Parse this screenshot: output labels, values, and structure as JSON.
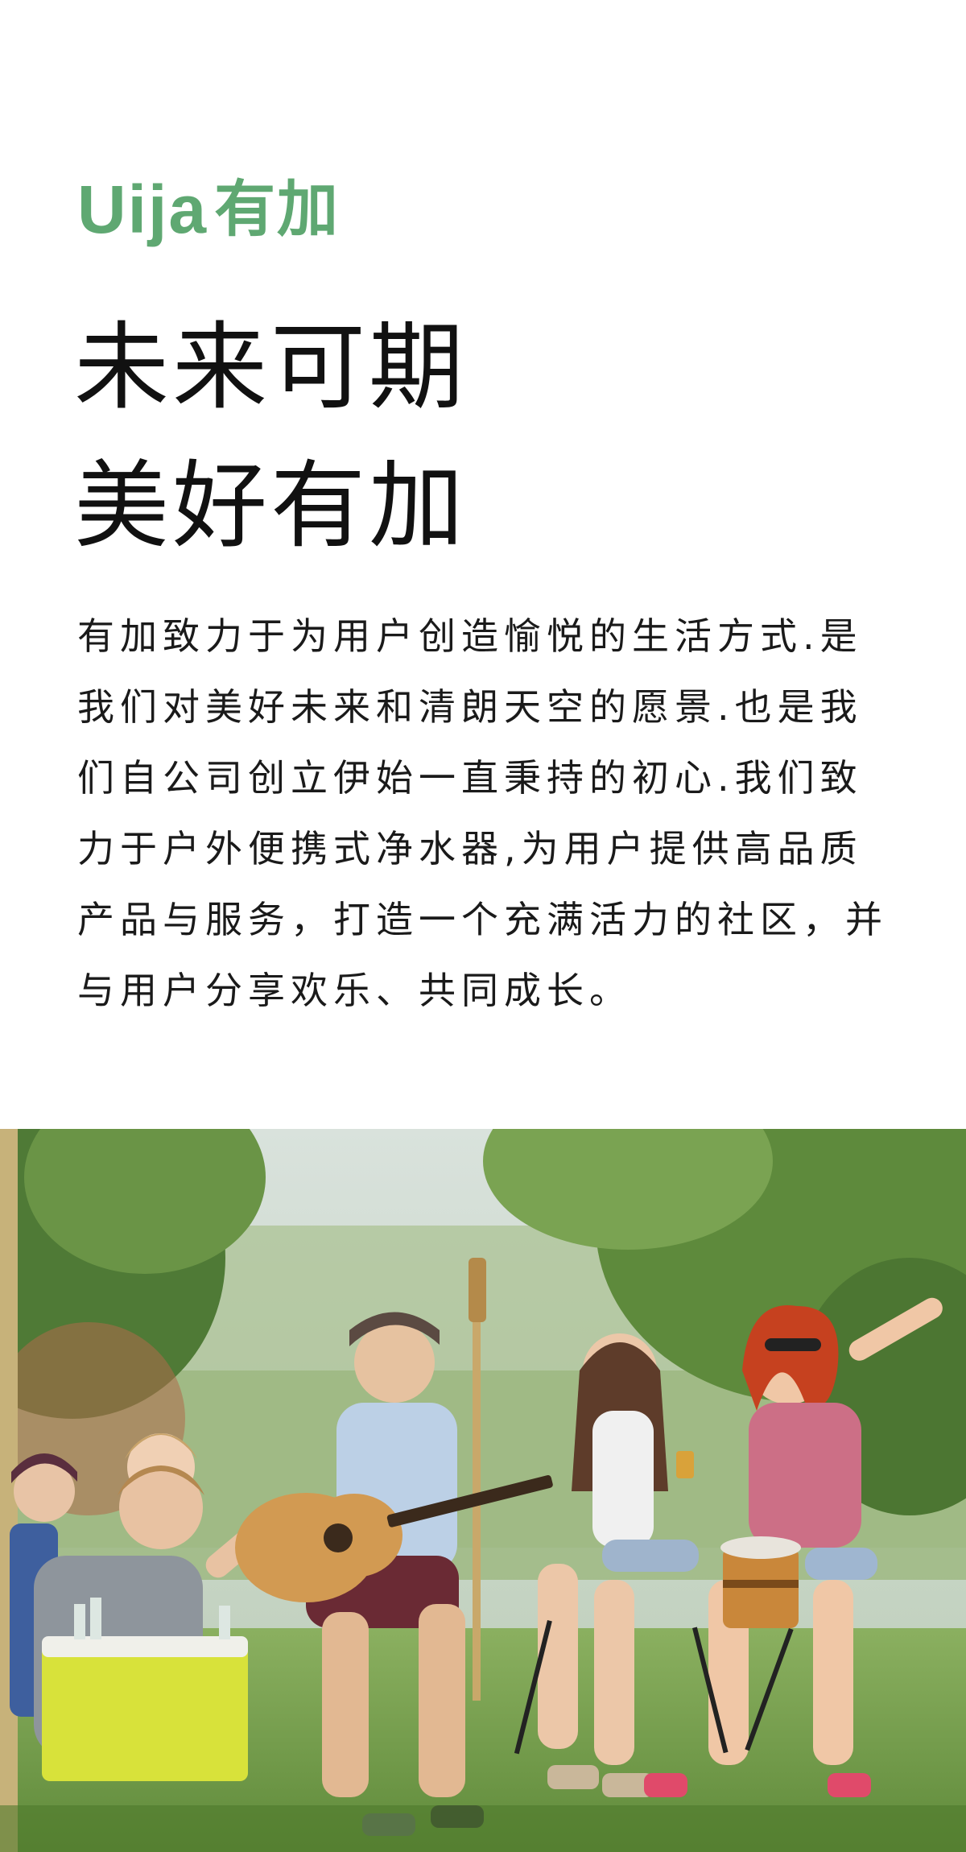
{
  "brand": {
    "logo_latin": "Uija",
    "logo_cn": "有加",
    "color": "#5fa872"
  },
  "headline": {
    "line1": "未来可期",
    "line2": "美好有加"
  },
  "intro": {
    "text": "有加致力于为用户创造愉悦的生活方式.是我们对美好未来和清朗天空的愿景.也是我们自公司创立伊始一直秉持的初心.我们致力于户外便携式净水器,为用户提供高品质产品与服务，打造一个充满活力的社区，并与用户分享欢乐、共同成长。"
  },
  "photo": {
    "subject": "friends-camping-music-outdoors"
  }
}
